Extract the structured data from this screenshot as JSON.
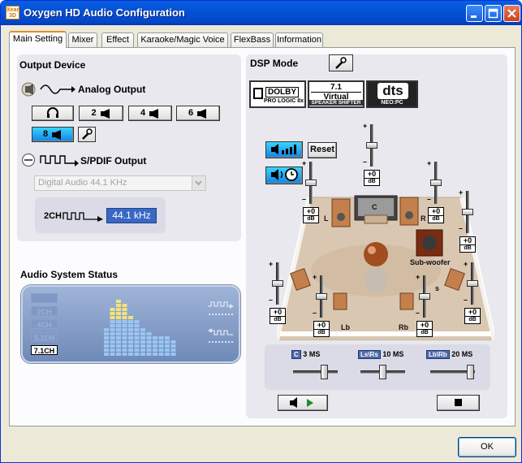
{
  "window": {
    "logo_text": "Xear 3D",
    "title": "Oxygen HD Audio Configuration"
  },
  "tabs": [
    {
      "label": "Main Setting",
      "active": true
    },
    {
      "label": "Mixer"
    },
    {
      "label": "Effect"
    },
    {
      "label": "Karaoke/Magic Voice"
    },
    {
      "label": "FlexBass"
    },
    {
      "label": "Information"
    }
  ],
  "output_device": {
    "title": "Output Device",
    "analog_label": "Analog Output",
    "channel_buttons": [
      "2",
      "4",
      "6",
      "8"
    ],
    "active_channel": "8",
    "spdif_label": "S/PDIF Output",
    "spdif_select": {
      "value": "Digital Audio 44.1 KHz"
    },
    "rate_label": "2CH",
    "rate_value": "44.1 kHz"
  },
  "audio_status": {
    "title": "Audio System Status",
    "channel_labels": [
      "",
      "2CH",
      "4CH",
      "5.1CH",
      "7.1CH"
    ],
    "active_label": "7.1CH",
    "meter_heights": [
      0,
      0,
      0,
      0,
      0.48,
      0.85,
      0.98,
      0.9,
      0.7,
      0.62,
      0.52,
      0.45,
      0.38,
      0.38,
      0.32,
      0.28,
      0,
      0,
      0,
      0
    ]
  },
  "dsp_mode": {
    "title": "DSP Mode",
    "logos": {
      "dolby_top": "DOLBY",
      "dolby_bottom": "PRO LOGIC IIx",
      "virtual_top": "7.1",
      "virtual_mid": "Virtual",
      "virtual_bottom": "SPEAKER SHIFTER",
      "dts_top": "dts",
      "dts_bottom": "NEO:PC"
    },
    "reset_label": "Reset",
    "sliders": [
      {
        "id": "l",
        "value": "+0",
        "unit": "dB",
        "level": 0.5
      },
      {
        "id": "c",
        "value": "+0",
        "unit": "dB",
        "level": 0.5
      },
      {
        "id": "r",
        "value": "+0",
        "unit": "dB",
        "level": 0.5
      },
      {
        "id": "sub",
        "value": "+0",
        "unit": "dB",
        "level": 0.5
      },
      {
        "id": "sl",
        "value": "+0",
        "unit": "dB",
        "level": 0.5
      },
      {
        "id": "lb",
        "value": "+0",
        "unit": "dB",
        "level": 0.5
      },
      {
        "id": "rb",
        "value": "+0",
        "unit": "dB",
        "level": 0.5
      },
      {
        "id": "sr",
        "value": "+0",
        "unit": "dB",
        "level": 0.5
      }
    ],
    "speaker_labels": {
      "l": "L",
      "c": "C",
      "r": "R",
      "sub": "Sub-woofer",
      "s": "s",
      "lb": "Lb",
      "rb": "Rb"
    },
    "delays": [
      {
        "tag": "C",
        "value": "3",
        "unit": "MS",
        "level": 0.75
      },
      {
        "tag": "Ls\\Rs",
        "value": "10",
        "unit": "MS",
        "level": 0.5
      },
      {
        "tag": "Lb\\Rb",
        "value": "20",
        "unit": "MS",
        "level": 1.0
      }
    ]
  },
  "footer": {
    "ok_label": "OK"
  }
}
